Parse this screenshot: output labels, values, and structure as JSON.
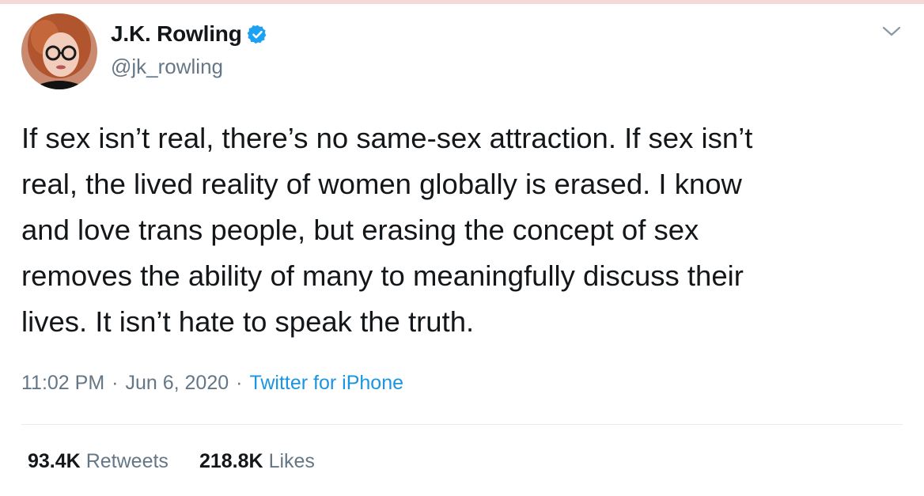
{
  "tweet": {
    "author": {
      "display_name": "J.K. Rowling",
      "handle": "@jk_rowling",
      "verified": true,
      "avatar_icon": "profile-photo"
    },
    "text_lines": [
      "If sex isn’t real, there’s no same-sex attraction. If sex isn’t",
      "real, the lived reality of women globally is erased. I know",
      "and love trans people, but erasing the concept of sex",
      "removes the ability of many to meaningfully discuss their",
      "lives. It isn’t hate to speak the truth."
    ],
    "time": "11:02 PM",
    "separator": "·",
    "date": "Jun 6, 2020",
    "source": "Twitter for iPhone",
    "stats": {
      "retweets_count": "93.4K",
      "retweets_label": "Retweets",
      "likes_count": "218.8K",
      "likes_label": "Likes"
    }
  },
  "colors": {
    "text": "#14171a",
    "secondary": "#657786",
    "accent": "#1b95e0",
    "verified": "#1da1f2",
    "divider": "#e6ecf0"
  },
  "icons": {
    "verified": "verified-badge-icon",
    "menu": "chevron-down-icon"
  }
}
